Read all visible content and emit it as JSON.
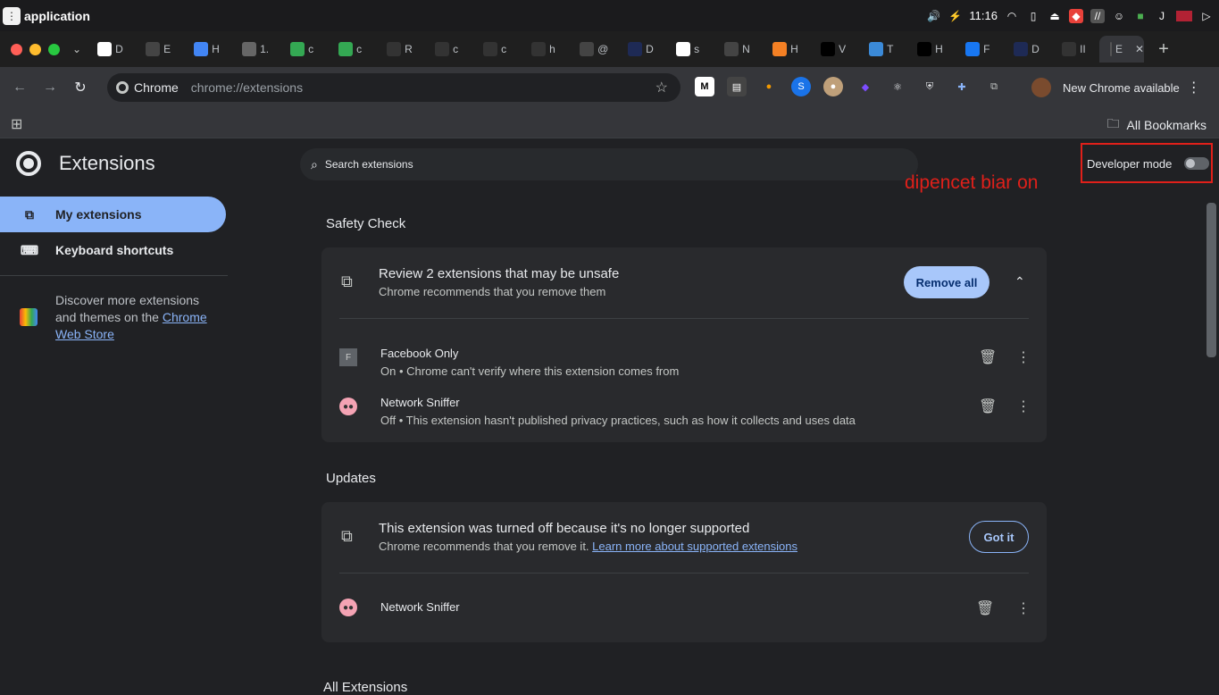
{
  "os_bar": {
    "app_name": "application",
    "clock": "11:16",
    "icons": [
      "volume-icon",
      "battery-icon",
      "clock-text",
      "wifi-icon",
      "clipboard-icon",
      "eject-icon",
      "app-tray-1",
      "app-tray-2",
      "discord-icon",
      "tray-box",
      "tray-j",
      "us-flag-icon",
      "power-icon"
    ]
  },
  "tabs": [
    {
      "label": "D",
      "icon": "r-icon"
    },
    {
      "label": "E",
      "icon": "openai-icon"
    },
    {
      "label": "H",
      "icon": "docs-icon"
    },
    {
      "label": "1.",
      "icon": "globe-icon"
    },
    {
      "label": "c",
      "icon": "chrome-icon"
    },
    {
      "label": "c",
      "icon": "chrome-icon"
    },
    {
      "label": "R",
      "icon": "github-icon"
    },
    {
      "label": "c",
      "icon": "github-icon"
    },
    {
      "label": "c",
      "icon": "github-icon"
    },
    {
      "label": "h",
      "icon": "github-icon"
    },
    {
      "label": "@",
      "icon": "arch-icon"
    },
    {
      "label": "D",
      "icon": "terminal-icon"
    },
    {
      "label": "s",
      "icon": "google-icon"
    },
    {
      "label": "N",
      "icon": "openai-icon"
    },
    {
      "label": "H",
      "icon": "stackoverflow-icon"
    },
    {
      "label": "V",
      "icon": "dev-icon"
    },
    {
      "label": "T",
      "icon": "cube-icon"
    },
    {
      "label": "H",
      "icon": "medium-icon"
    },
    {
      "label": "F",
      "icon": "facebook-icon"
    },
    {
      "label": "D",
      "icon": "terminal-icon"
    },
    {
      "label": "II",
      "icon": "github-icon"
    },
    {
      "label": "E",
      "icon": "extensions-icon"
    }
  ],
  "toolbar": {
    "chip_label": "Chrome",
    "url": "chrome://extensions",
    "new_chrome": "New Chrome available"
  },
  "bookmarks": {
    "all_bookmarks": "All Bookmarks"
  },
  "sidebar": {
    "title": "Extensions",
    "items": [
      {
        "label": "My extensions"
      },
      {
        "label": "Keyboard shortcuts"
      }
    ],
    "discover_prefix": "Discover more extensions and themes on the ",
    "discover_link": "Chrome Web Store"
  },
  "search": {
    "placeholder": "Search extensions"
  },
  "dev_mode": {
    "label": "Developer mode",
    "enabled": false
  },
  "annotation": "dipencet biar on",
  "safety_check": {
    "heading": "Safety Check",
    "card_title": "Review 2 extensions that may be unsafe",
    "card_sub": "Chrome recommends that you remove them",
    "remove_all": "Remove all",
    "extensions": [
      {
        "name": "Facebook Only",
        "desc": "On • Chrome can't verify where this extension comes from",
        "icon": "F"
      },
      {
        "name": "Network Sniffer",
        "desc": "Off • This extension hasn't published privacy practices, such as how it collects and uses data",
        "icon": "pig"
      }
    ]
  },
  "updates": {
    "heading": "Updates",
    "card_title": "This extension was turned off because it's no longer supported",
    "card_sub": "Chrome recommends that you remove it. ",
    "card_link": "Learn more about supported extensions",
    "got_it": "Got it",
    "extensions": [
      {
        "name": "Network Sniffer",
        "icon": "pig"
      }
    ]
  },
  "bottom_text": "All Extensions",
  "colors": {
    "accent": "#8ab4f8",
    "annotation": "#e0201a",
    "background": "#202124"
  }
}
